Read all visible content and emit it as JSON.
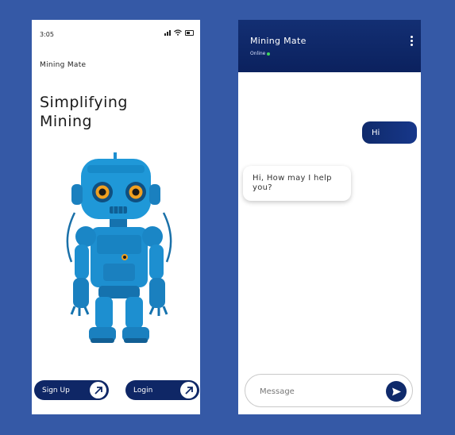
{
  "left_screen": {
    "status": {
      "time": "3:05"
    },
    "app_name": "Mining Mate",
    "headline_line1": "Simplifying",
    "headline_line2": "Mining",
    "buttons": {
      "signup": "Sign Up",
      "login": "Login"
    }
  },
  "right_screen": {
    "header": {
      "title": "Mining Mate",
      "status": "Online"
    },
    "messages": [
      {
        "from": "user",
        "text": "Hi"
      },
      {
        "from": "bot",
        "text": "Hi, How may I help you?"
      }
    ],
    "input": {
      "placeholder": "Message"
    }
  },
  "colors": {
    "background": "#3559a6",
    "primary_navy": "#0f2766",
    "online_green": "#3dd65c",
    "robot_blue": "#1d8fd0"
  },
  "icons": [
    "signal-icon",
    "wifi-icon",
    "battery-icon",
    "arrow-up-right-icon",
    "more-vertical-icon",
    "send-icon",
    "robot-illustration"
  ]
}
